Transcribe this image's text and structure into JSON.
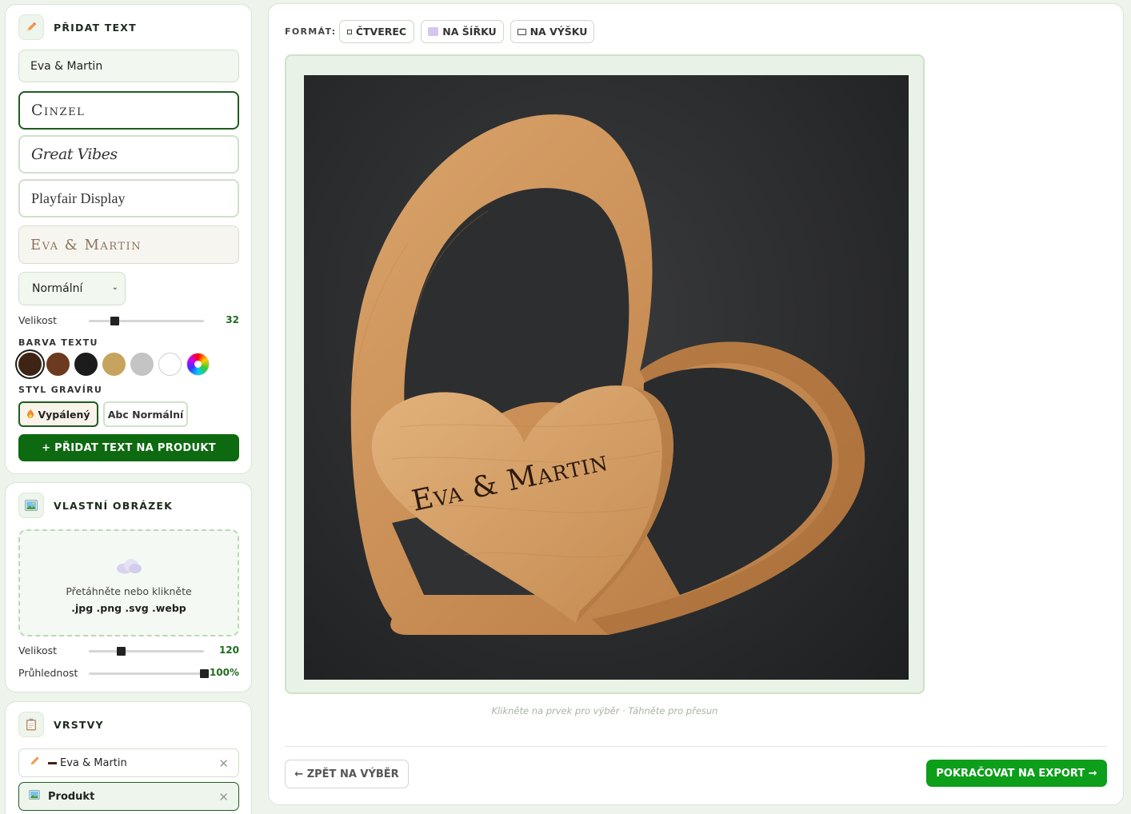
{
  "text_panel": {
    "title": "PŘIDAT TEXT",
    "icon": "pencil-icon",
    "text_value": "Eva & Martin",
    "fonts": [
      "Cinzel",
      "Great Vibes",
      "Playfair Display"
    ],
    "selected_font": "Cinzel",
    "preview_text": "Eva & Martin",
    "weight_select": "Normální",
    "size_label": "Velikost",
    "size_value": "32",
    "size_fraction": 0.22,
    "color_label": "BARVA TEXTU",
    "colors": [
      "#3e2414",
      "#6b3a1f",
      "#1c1c1c",
      "#c6a45e",
      "#c4c4c4",
      "#ffffff"
    ],
    "selected_color": "#3e2414",
    "engrave_label": "STYL GRAVÍRU",
    "engrave_burned": "Vypálený",
    "engrave_normal": "Abc Normální",
    "add_button": "+ PŘIDAT TEXT NA PRODUKT"
  },
  "image_panel": {
    "title": "VLASTNÍ OBRÁZEK",
    "icon": "picture-icon",
    "drop_line1": "Přetáhněte nebo klikněte",
    "drop_line2": ".jpg .png .svg .webp",
    "size_label": "Velikost",
    "size_value": "120",
    "size_fraction": 0.28,
    "opacity_label": "Průhlednost",
    "opacity_value": "100%",
    "opacity_fraction": 1.0
  },
  "layers_panel": {
    "title": "VRSTVY",
    "icon": "clipboard-icon",
    "layers": [
      {
        "label": "Eva & Martin",
        "icon": "pencil-icon"
      },
      {
        "label": "Produkt",
        "icon": "picture-icon"
      }
    ]
  },
  "main": {
    "format_label": "FORMÁT:",
    "formats": [
      "ČTVEREC",
      "NA ŠÍŘKU",
      "NA VÝŠKU"
    ],
    "engraved_text": "Eva & Martin",
    "hint": "Klikněte na prvek pro výběr · Táhněte pro přesun",
    "back_button": "← ZPĚT NA VÝBĚR",
    "next_button": "POKRAČOVAT NA EXPORT →"
  }
}
